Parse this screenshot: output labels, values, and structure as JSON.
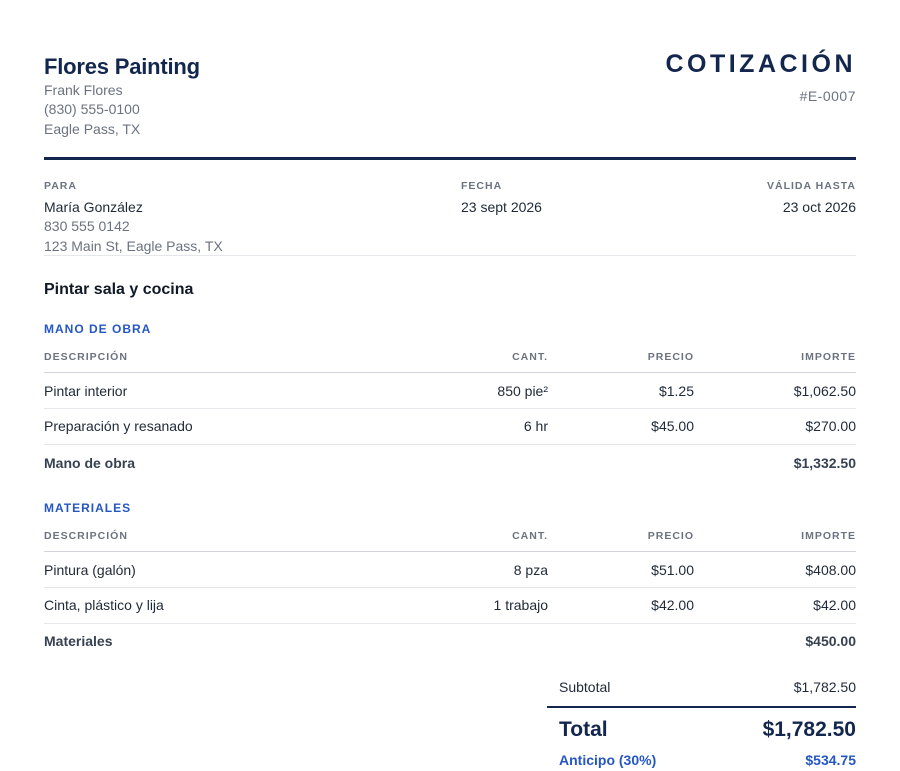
{
  "company": {
    "name": "Flores Painting",
    "owner": "Frank Flores",
    "phone": "(830) 555-0100",
    "location": "Eagle Pass, TX"
  },
  "document": {
    "title": "COTIZACIÓN",
    "number": "#E-0007"
  },
  "client": {
    "label": "PARA",
    "name": "María González",
    "phone": "830 555 0142",
    "address": "123 Main St, Eagle Pass, TX"
  },
  "dates": {
    "date_label": "FECHA",
    "date": "23 sept 2026",
    "valid_label": "VÁLIDA HASTA",
    "valid": "23 oct 2026"
  },
  "project": {
    "title": "Pintar sala y cocina"
  },
  "columns": {
    "description": "DESCRIPCIÓN",
    "qty": "CANT.",
    "price": "PRECIO",
    "amount": "IMPORTE"
  },
  "sections": [
    {
      "title": "MANO DE OBRA",
      "items": [
        {
          "description": "Pintar interior",
          "qty": "850 pie²",
          "price": "$1.25",
          "amount": "$1,062.50"
        },
        {
          "description": "Preparación y resanado",
          "qty": "6 hr",
          "price": "$45.00",
          "amount": "$270.00"
        }
      ],
      "subtotal_label": "Mano de obra",
      "subtotal": "$1,332.50"
    },
    {
      "title": "MATERIALES",
      "items": [
        {
          "description": "Pintura (galón)",
          "qty": "8 pza",
          "price": "$51.00",
          "amount": "$408.00"
        },
        {
          "description": "Cinta, plástico y lija",
          "qty": "1 trabajo",
          "price": "$42.00",
          "amount": "$42.00"
        }
      ],
      "subtotal_label": "Materiales",
      "subtotal": "$450.00"
    }
  ],
  "totals": {
    "subtotal_label": "Subtotal",
    "subtotal": "$1,782.50",
    "total_label": "Total",
    "total": "$1,782.50",
    "deposit_label": "Anticipo (30%)",
    "deposit": "$534.75"
  },
  "colors": {
    "navy": "#13264d",
    "accent_blue": "#2457c5"
  }
}
